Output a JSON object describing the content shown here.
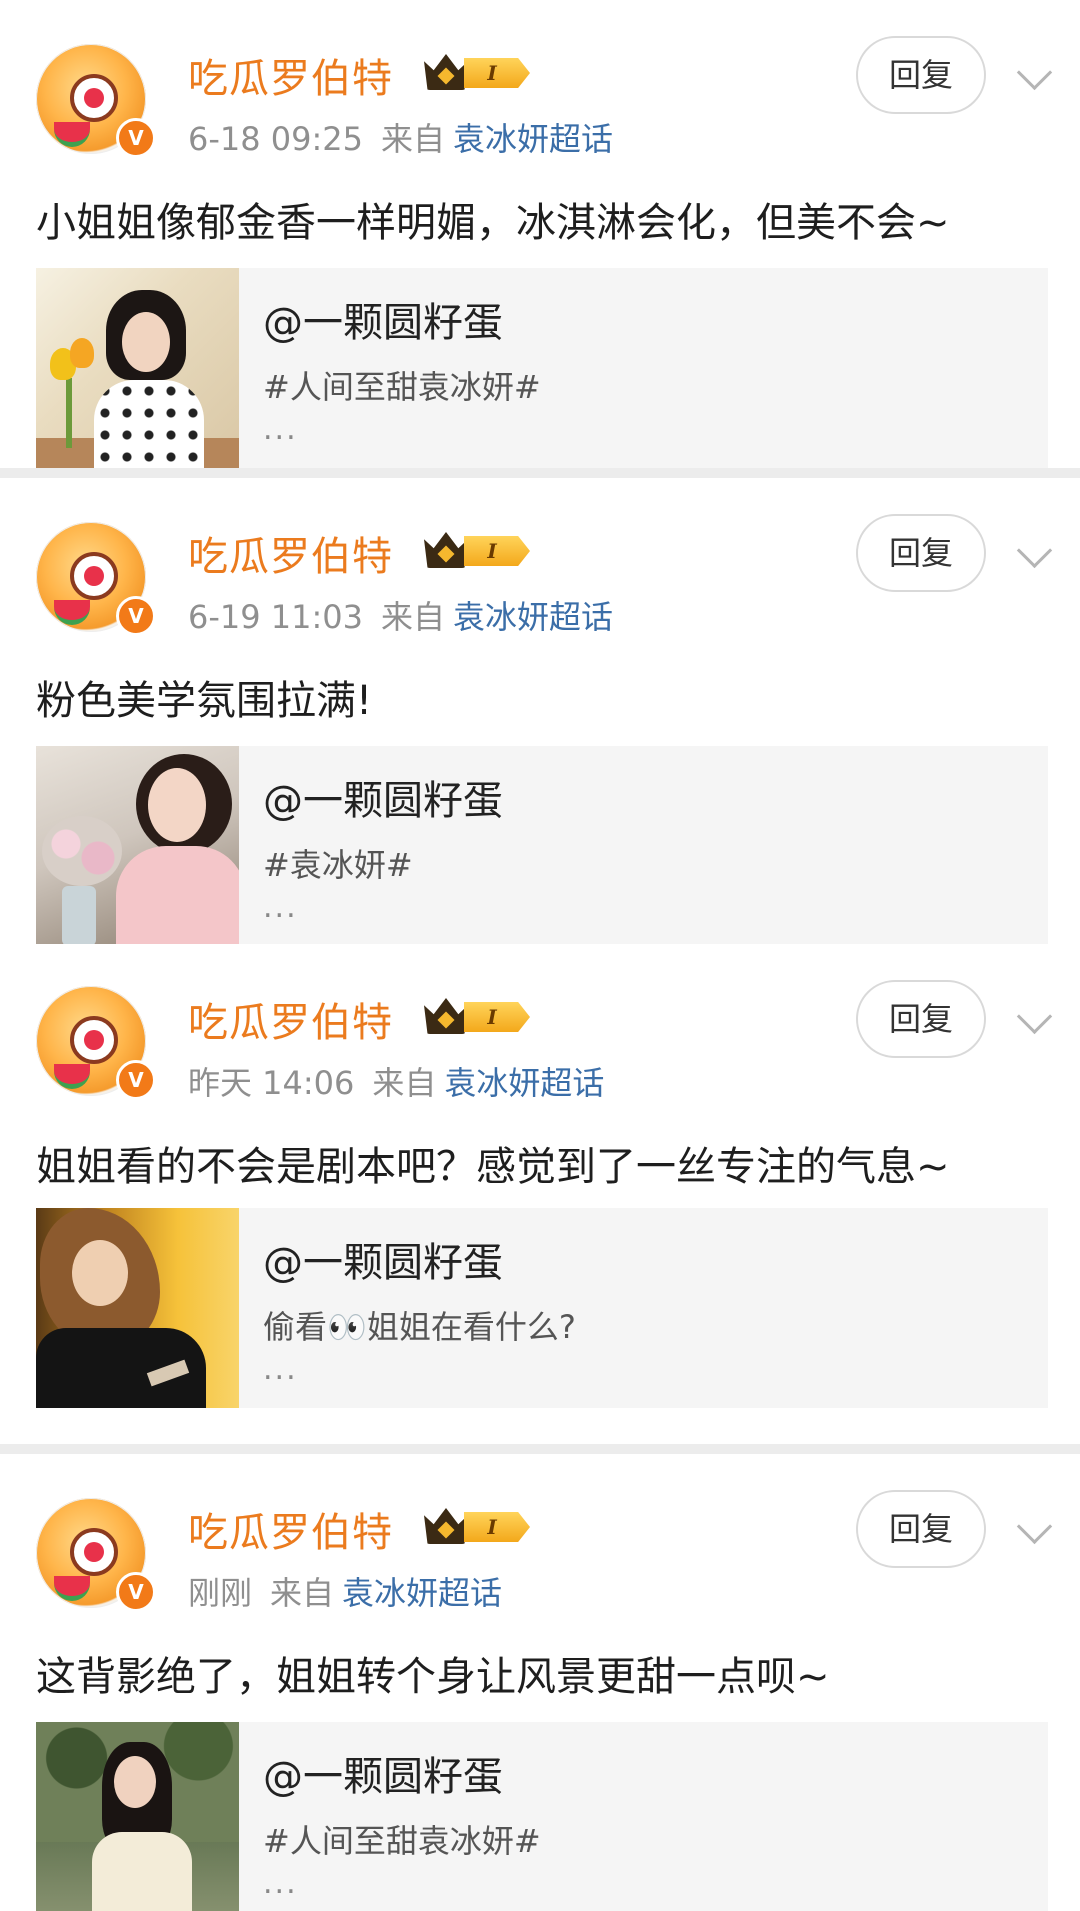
{
  "comments": [
    {
      "username": "吃瓜罗伯特",
      "vip_level": "I",
      "time": "6-18 09:25",
      "from_label": "来自",
      "source": "袁冰妍超话",
      "reply_label": "回复",
      "text": "小姐姐像郁金香一样明媚，冰淇淋会化，但美不会~",
      "quote": {
        "author": "@一颗圆籽蛋",
        "text": "#人间至甜袁冰妍#",
        "more": "..."
      }
    },
    {
      "username": "吃瓜罗伯特",
      "vip_level": "I",
      "time": "6-19 11:03",
      "from_label": "来自",
      "source": "袁冰妍超话",
      "reply_label": "回复",
      "text": "粉色美学氛围拉满!",
      "quote": {
        "author": "@一颗圆籽蛋",
        "text": "#袁冰妍#",
        "more": "..."
      }
    },
    {
      "username": "吃瓜罗伯特",
      "vip_level": "I",
      "time": "昨天 14:06",
      "from_label": "来自",
      "source": "袁冰妍超话",
      "reply_label": "回复",
      "text": "姐姐看的不会是剧本吧？感觉到了一丝专注的气息~",
      "quote": {
        "author": "@一颗圆籽蛋",
        "text": "偷看👀姐姐在看什么?",
        "more": "..."
      }
    },
    {
      "username": "吃瓜罗伯特",
      "vip_level": "I",
      "time": "刚刚",
      "from_label": "来自",
      "source": "袁冰妍超话",
      "reply_label": "回复",
      "text": "这背影绝了，姐姐转个身让风景更甜一点呗~",
      "quote": {
        "author": "@一颗圆籽蛋",
        "text": "#人间至甜袁冰妍#",
        "more": "..."
      }
    }
  ],
  "colors": {
    "username": "#eb7b1e",
    "topic_link": "#3b6ea8",
    "meta": "#8f8f8f",
    "quote_bg": "#f5f5f5",
    "separator": "#ececec"
  }
}
